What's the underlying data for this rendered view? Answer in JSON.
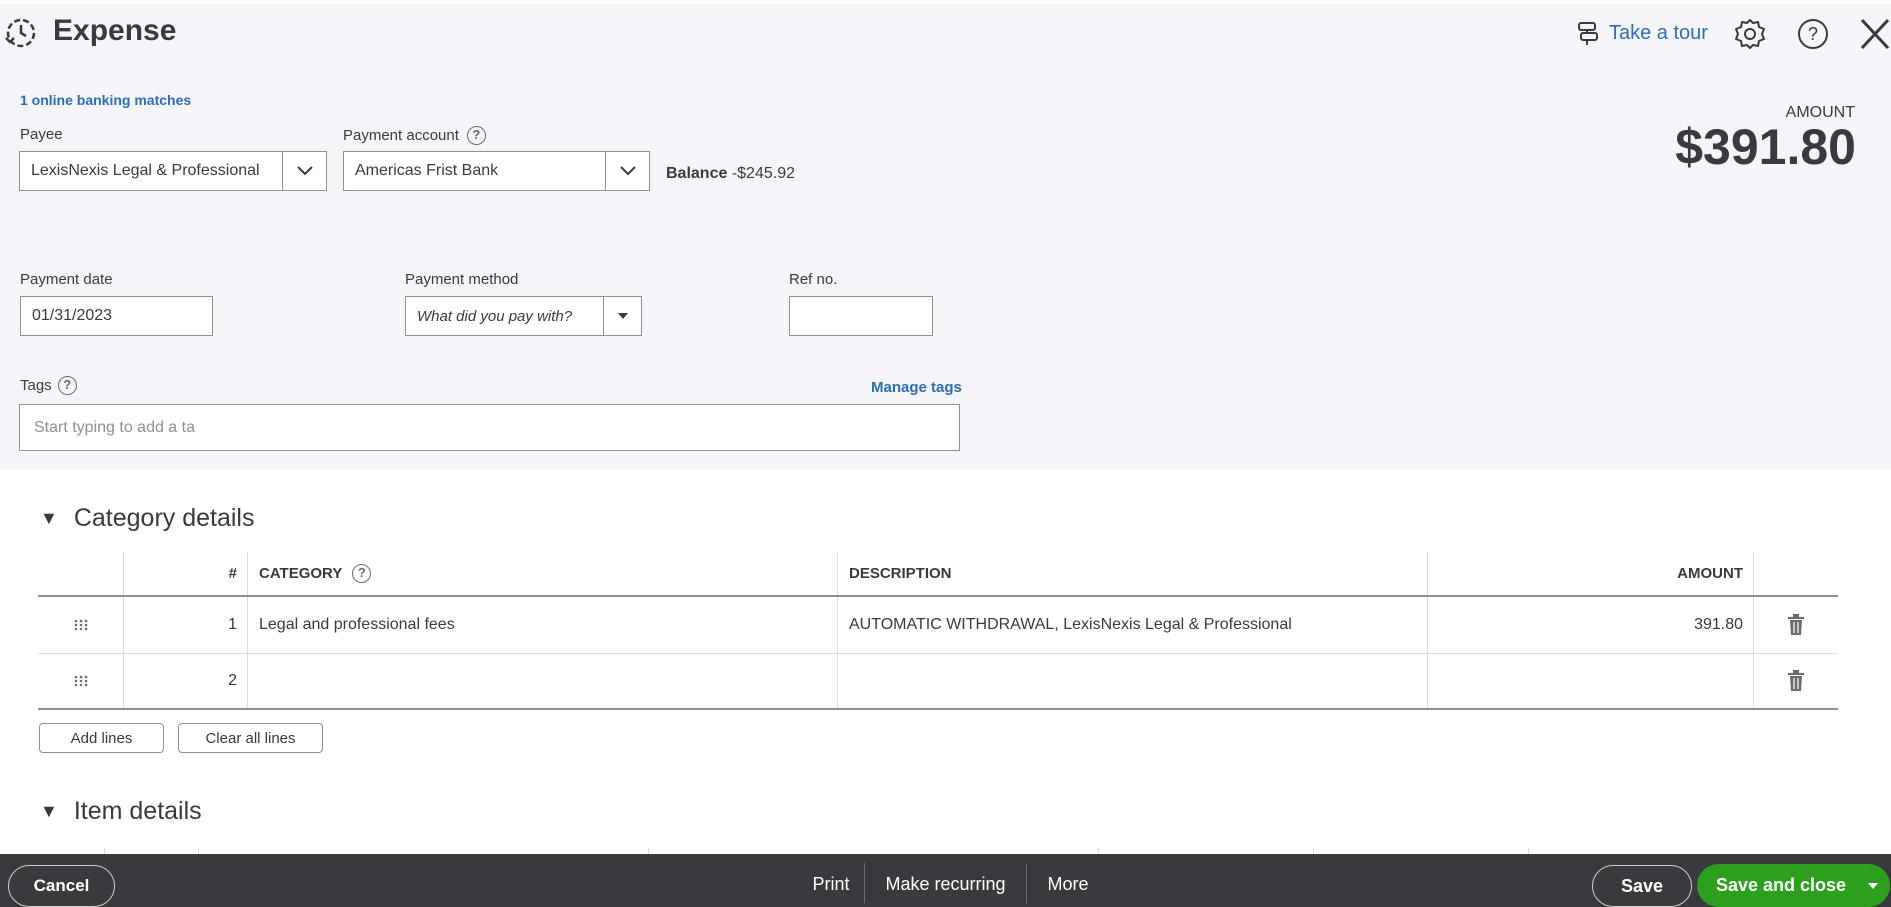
{
  "header": {
    "title": "Expense",
    "take_tour": "Take a tour"
  },
  "banking": {
    "matches_link": "1 online banking matches"
  },
  "payee": {
    "label": "Payee",
    "value": "LexisNexis Legal & Professional"
  },
  "payment_account": {
    "label": "Payment account",
    "value": "Americas Frist Bank",
    "balance_label": "Balance",
    "balance_value": "-$245.92"
  },
  "amount": {
    "label": "AMOUNT",
    "value": "$391.80"
  },
  "payment_date": {
    "label": "Payment date",
    "value": "01/31/2023"
  },
  "payment_method": {
    "label": "Payment method",
    "placeholder": "What did you pay with?"
  },
  "ref_no": {
    "label": "Ref no.",
    "value": ""
  },
  "tags": {
    "label": "Tags",
    "manage_link": "Manage tags",
    "placeholder": "Start typing to add a ta"
  },
  "category_details": {
    "title": "Category details",
    "columns": {
      "num": "#",
      "category": "CATEGORY",
      "description": "DESCRIPTION",
      "amount": "AMOUNT"
    },
    "rows": [
      {
        "num": "1",
        "category": "Legal and professional fees",
        "description": "AUTOMATIC WITHDRAWAL, LexisNexis Legal & Professional",
        "amount": "391.80"
      },
      {
        "num": "2",
        "category": "",
        "description": "",
        "amount": ""
      }
    ],
    "add_lines": "Add lines",
    "clear_lines": "Clear all lines"
  },
  "item_details": {
    "title": "Item details"
  },
  "footer": {
    "cancel": "Cancel",
    "print": "Print",
    "make_recurring": "Make recurring",
    "more": "More",
    "save": "Save",
    "save_and_close": "Save and close"
  },
  "colors": {
    "accent_link": "#2d6db5",
    "footer_bg": "#393a3d",
    "save_green": "#2ca01c",
    "form_bg": "#f4f5f8"
  }
}
